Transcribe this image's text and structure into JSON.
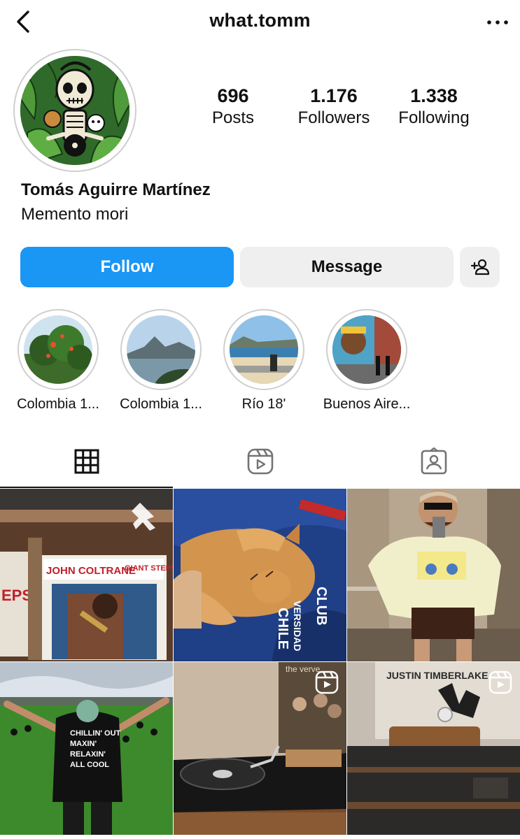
{
  "header": {
    "username": "what.tomm"
  },
  "profile": {
    "stats": [
      {
        "value": "696",
        "label": "Posts"
      },
      {
        "value": "1.176",
        "label": "Followers"
      },
      {
        "value": "1.338",
        "label": "Following"
      }
    ],
    "full_name": "Tomás Aguirre Martínez",
    "bio": "Memento mori"
  },
  "actions": {
    "follow_label": "Follow",
    "message_label": "Message",
    "add_user_icon": "add-user-icon"
  },
  "colors": {
    "follow_blue": "#1a96f5",
    "secondary_btn": "#efefef"
  },
  "highlights": [
    {
      "label": "Colombia 1..."
    },
    {
      "label": "Colombia 1..."
    },
    {
      "label": "Río 18'"
    },
    {
      "label": "Buenos Aire..."
    }
  ],
  "tabs": [
    {
      "icon": "grid-icon",
      "active": true
    },
    {
      "icon": "reels-icon",
      "active": false
    },
    {
      "icon": "tagged-icon",
      "active": false
    }
  ],
  "posts": [
    {
      "type": "pinned",
      "overlay_icon": "pin-icon",
      "lettering": [
        "JOHN COLTRANE",
        "GIANT STEPS",
        "EPS"
      ]
    },
    {
      "type": "photo",
      "lettering": [
        "CLUB",
        "VERSIDAD",
        "CHILE"
      ]
    },
    {
      "type": "photo",
      "lettering": []
    },
    {
      "type": "photo",
      "lettering": [
        "CHILLIN' OUT",
        "MAXIN'",
        "RELAXIN'",
        "ALL COOL"
      ]
    },
    {
      "type": "reel",
      "overlay_icon": "reel-icon",
      "lettering": [
        "the verve"
      ]
    },
    {
      "type": "reel",
      "overlay_icon": "reel-icon",
      "lettering": [
        "JUSTIN TIMBERLAKE"
      ]
    }
  ]
}
